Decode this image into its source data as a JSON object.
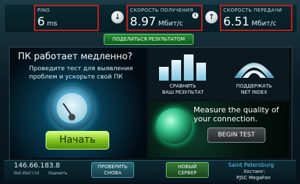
{
  "stats": {
    "ping": {
      "label": "PING",
      "value": "6",
      "unit": "ms"
    },
    "download": {
      "label": "СКОРОСТЬ ПОЛУЧЕНИЯ",
      "value": "8.97",
      "unit": "Мбит/с"
    },
    "upload": {
      "label": "СКОРОСТЬ ПЕРЕДАЧИ",
      "value": "6.51",
      "unit": "Мбит/с"
    }
  },
  "share_button": "ПОДЕЛИТЬСЯ РЕЗУЛЬТАТОМ",
  "ad_left": {
    "title": "ПК работает медленно?",
    "subtitle": "Проведите тест для выявления проблем и ускорьте свой ПК",
    "start_button": "Начать"
  },
  "tiles": {
    "compare": "СРАВНИТЬ\nВАШ РЕЗУЛЬТАТ",
    "netindex": "ПОДДЕРЖАТЬ\nNET INDEX"
  },
  "ad_right": {
    "title": "Measure the quality of your connection.",
    "button": "BEGIN TEST"
  },
  "bottom": {
    "ip": "146.66.183.8",
    "isp": "Net-Wall Ltd",
    "rating": "Оценить",
    "retest": "ПРОВЕРИТЬ\nСНОВА",
    "new_server": "НОВЫЙ\nСЕРВЕР",
    "city": "Saint Petersburg",
    "host_label": "Хостинг:",
    "host": "PJSC MegaFon"
  },
  "icons": {
    "download": "arrow-down-icon",
    "upload": "arrow-up-icon",
    "info": "info-icon"
  },
  "colors": {
    "highlight": "#c81e1e",
    "share_green": "#2a8e3a",
    "start_green": "#7fc01d",
    "city_blue": "#5ad2ff"
  }
}
